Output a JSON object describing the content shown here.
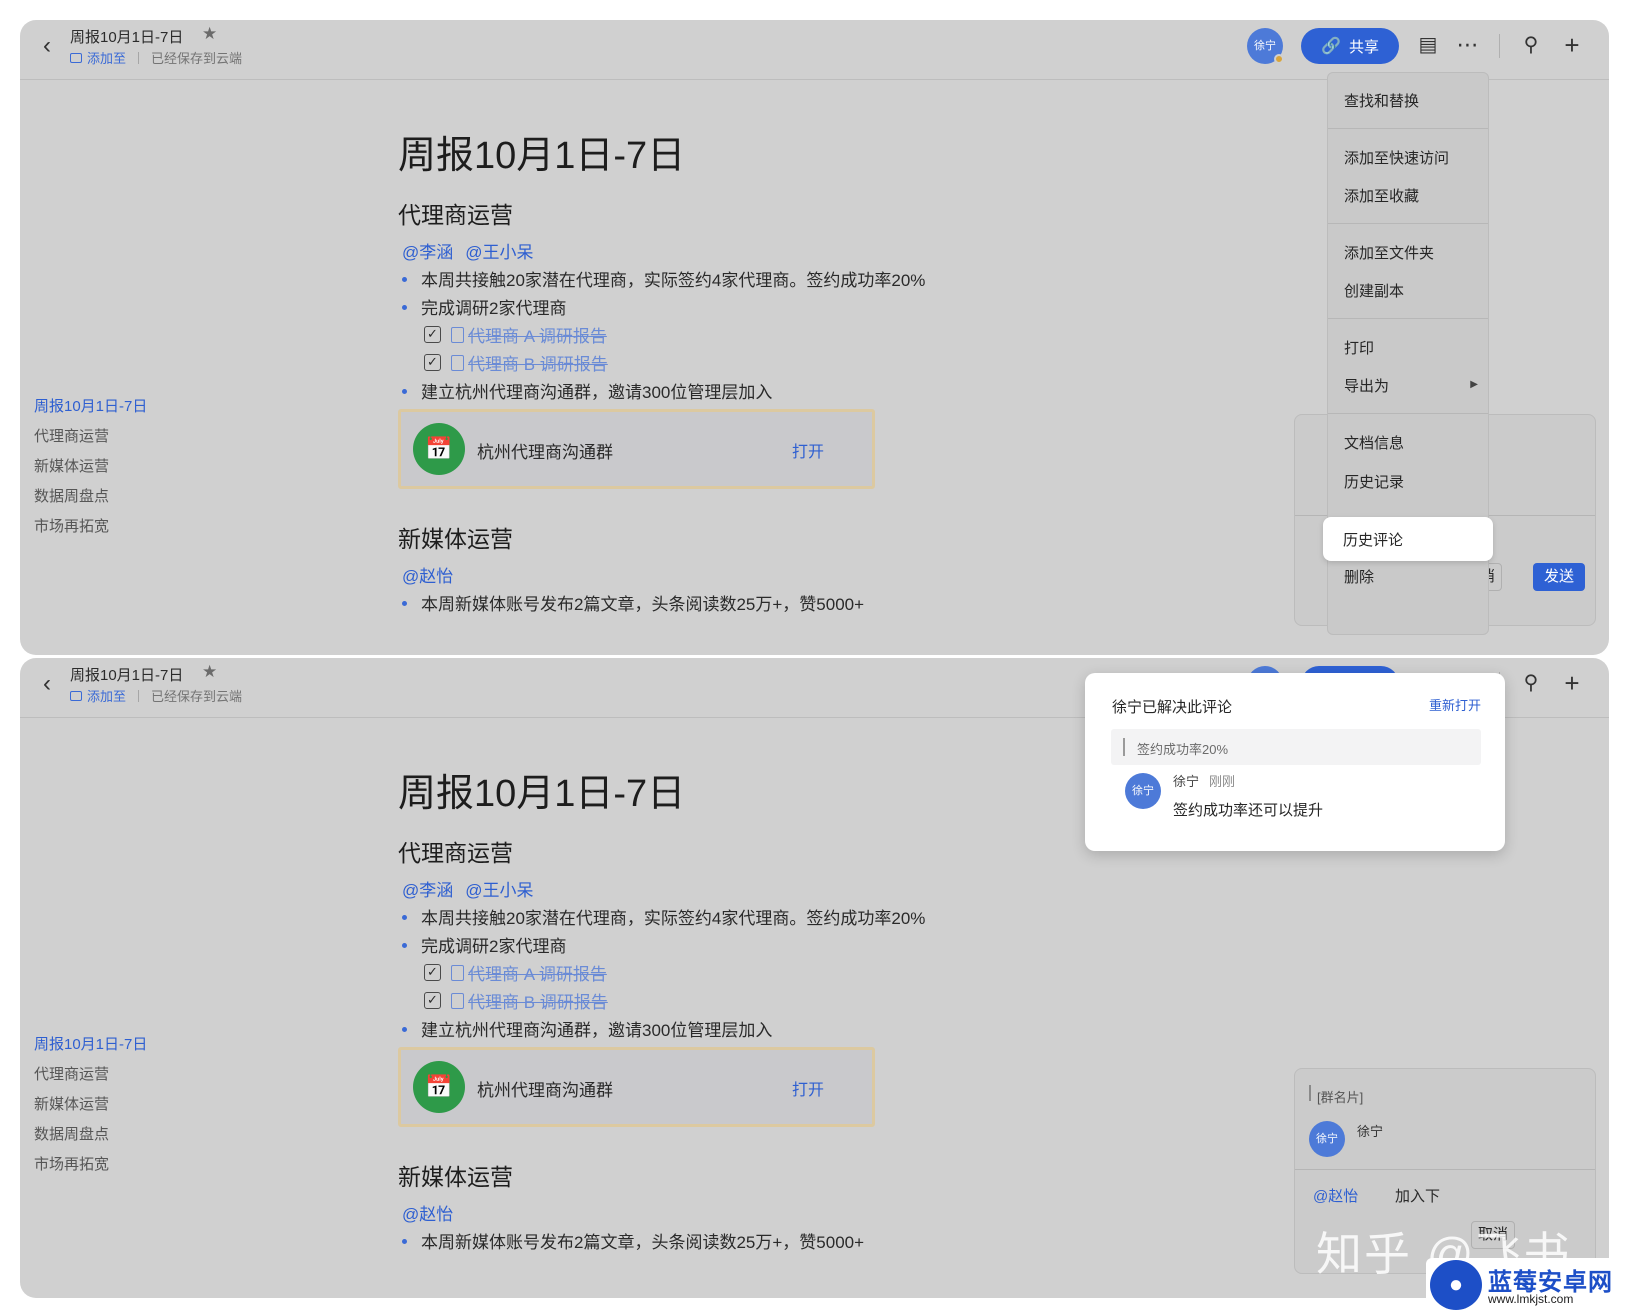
{
  "header": {
    "doc_title": "周报10月1日-7日",
    "add_to": "添加至",
    "saved_status": "已经保存到云端",
    "avatar_label": "徐宁",
    "share_label": "共享"
  },
  "outline": {
    "items": [
      "周报10月1日-7日",
      "代理商运营",
      "新媒体运营",
      "数据周盘点",
      "市场再拓宽"
    ]
  },
  "doc": {
    "title": "周报10月1日-7日",
    "section1": {
      "heading": "代理商运营",
      "mentions": [
        "@李涵",
        "@王小呆"
      ],
      "bullet1": "本周共接触20家潜在代理商，实际签约4家代理商。签约成功率20%",
      "bullet2": "完成调研2家代理商",
      "task1": "代理商 A 调研报告",
      "task2": "代理商 B 调研报告",
      "bullet3": "建立杭州代理商沟通群，邀请300位管理层加入",
      "group_name": "杭州代理商沟通群",
      "group_open": "打开"
    },
    "section2": {
      "heading": "新媒体运营",
      "mention": "@赵怡",
      "bullet1": "本周新媒体账号发布2篇文章，头条阅读数25万+，赞5000+"
    }
  },
  "menu": {
    "items": [
      "查找和替换",
      "添加至快速访问",
      "添加至收藏",
      "添加至文件夹",
      "创建副本",
      "打印",
      "导出为",
      "文档信息",
      "历史记录",
      "历史评论",
      "删除"
    ],
    "highlighted": "历史评论",
    "cancel_partial": "消",
    "send": "发送"
  },
  "comment_popup": {
    "title": "徐宁已解决此评论",
    "reopen": "重新打开",
    "quote": "签约成功率20%",
    "author": "徐宁",
    "time": "刚刚",
    "text": "签约成功率还可以提升"
  },
  "comment_card": {
    "quote_label": "[群名片]",
    "author": "徐宁",
    "mention": "@赵怡",
    "after_mention": "加入下",
    "cancel": "取消"
  },
  "watermark": {
    "text": "知乎 @飞书",
    "brand_name": "蓝莓安卓网",
    "brand_url": "www.lmkjst.com"
  },
  "colors": {
    "accent": "#2e61d4",
    "overlay_gray": "#d0d0d0",
    "group_green": "#2e9a49"
  }
}
